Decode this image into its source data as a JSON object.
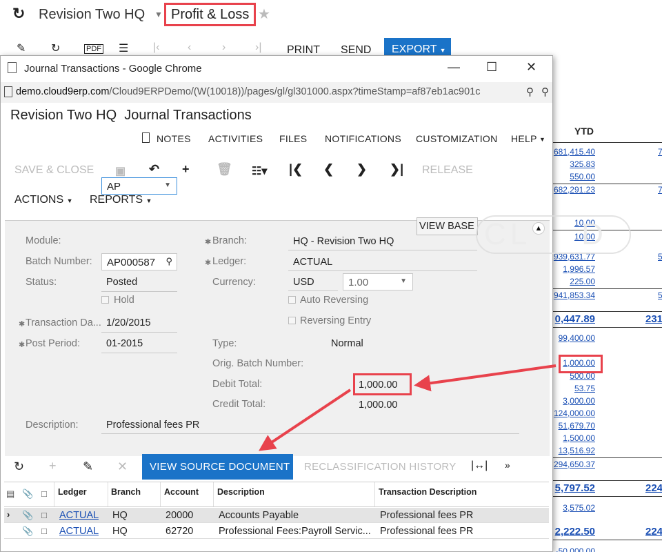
{
  "bg": {
    "company": "Revision Two HQ",
    "report_title": "Profit & Loss",
    "toolbar": {
      "print": "PRINT",
      "send": "SEND",
      "export": "EXPORT"
    },
    "report": {
      "ytd_header": "YTD",
      "values": [
        "681,415.40",
        "325.83",
        "550.00",
        "682,291.23",
        "10.00",
        "10.00",
        "939,631.77",
        "1,996.57",
        "225.00",
        "941,853.34",
        "0,447.89",
        "99,400.00",
        "1,000.00",
        "500.00",
        "53.75",
        "3,000.00",
        "124,000.00",
        "51,679.70",
        "1,500.00",
        "13,516.92",
        "294,650.37",
        "5,797.52",
        "3,575.02",
        "2,222.50",
        "-50,000.00"
      ],
      "col2": [
        "7",
        "7",
        "5",
        "5",
        "231",
        "224",
        "224"
      ]
    }
  },
  "popup": {
    "window_title": "Journal Transactions - Google Chrome",
    "url_host": "demo.cloud9erp.com",
    "url_path": "/Cloud9ERPDemo/(W(10018))/pages/gl/gl301000.aspx?timeStamp=af87eb1ac901c",
    "page_company": "Revision Two HQ",
    "page_title": "Journal Transactions",
    "menu": [
      "NOTES",
      "ACTIVITIES",
      "FILES",
      "NOTIFICATIONS",
      "CUSTOMIZATION",
      "HELP"
    ],
    "actions": {
      "save_close": "SAVE & CLOSE",
      "release": "RELEASE",
      "actions_menu": "ACTIONS",
      "reports_menu": "REPORTS"
    },
    "form": {
      "module_label": "Module:",
      "module_value": "AP",
      "batch_label": "Batch Number:",
      "batch_value": "AP000587",
      "status_label": "Status:",
      "status_value": "Posted",
      "hold_label": "Hold",
      "trandate_label": "Transaction Da...",
      "trandate_value": "1/20/2015",
      "period_label": "Post Period:",
      "period_value": "01-2015",
      "branch_label": "Branch:",
      "branch_value": "HQ - Revision Two HQ",
      "ledger_label": "Ledger:",
      "ledger_value": "ACTUAL",
      "currency_label": "Currency:",
      "currency_value": "USD",
      "rate_value": "1.00",
      "view_base": "VIEW BASE",
      "auto_reversing": "Auto Reversing",
      "reversing_entry": "Reversing Entry",
      "type_label": "Type:",
      "type_value": "Normal",
      "orig_batch_label": "Orig. Batch Number:",
      "debit_label": "Debit Total:",
      "debit_value": "1,000.00",
      "credit_label": "Credit Total:",
      "credit_value": "1,000.00",
      "desc_label": "Description:",
      "desc_value": "Professional fees PR"
    },
    "grid_toolbar": {
      "view_source": "VIEW SOURCE DOCUMENT",
      "reclass_history": "RECLASSIFICATION HISTORY"
    },
    "grid": {
      "columns": [
        "Ledger",
        "Branch",
        "Account",
        "Description",
        "Transaction Description"
      ],
      "rows": [
        {
          "ledger": "ACTUAL",
          "branch": "HQ",
          "account": "20000",
          "description": "Accounts Payable",
          "tran_desc": "Professional fees PR"
        },
        {
          "ledger": "ACTUAL",
          "branch": "HQ",
          "account": "62720",
          "description": "Professional Fees:Payroll Servic...",
          "tran_desc": "Professional fees PR"
        }
      ]
    }
  },
  "colors": {
    "accent": "#1a73c8",
    "highlight": "#e8424c",
    "link": "#1a4fb4"
  }
}
